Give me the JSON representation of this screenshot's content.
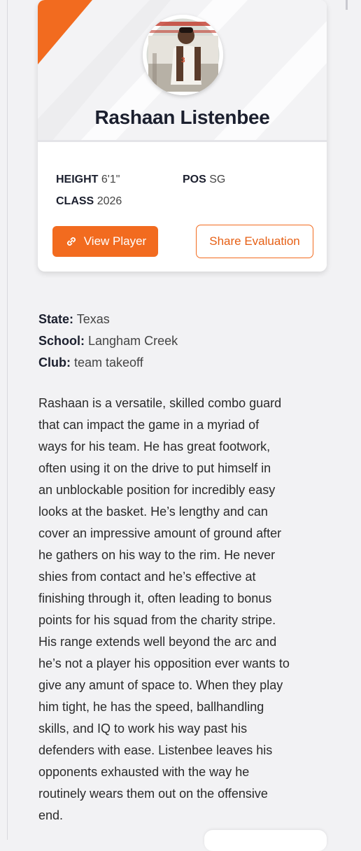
{
  "player": {
    "name": "Rashaan Listenbee",
    "height_label": "HEIGHT",
    "height_value": "6'1\"",
    "pos_label": "POS",
    "pos_value": "SG",
    "class_label": "CLASS",
    "class_value": "2026"
  },
  "actions": {
    "view_player": "View Player",
    "share_evaluation": "Share Evaluation"
  },
  "details": {
    "state_label": "State:",
    "state_value": "Texas",
    "school_label": "School:",
    "school_value": "Langham Creek",
    "club_label": "Club:",
    "club_value": "team takeoff"
  },
  "evaluation": "Rashaan is a versatile, skilled combo guard\nthat can impact the game in a myriad of\nways for his team. He has great footwork,\noften using it on the drive to put himself in\nan unblockable position for incredibly easy\nlooks at the basket. He’s lengthy and can\ncover an impressive amount of ground after\nhe gathers on his way to the rim. He never\nshies from contact and he’s effective at\nfinishing through it, often leading to bonus\npoints for his squad from the charity stripe.\nHis range extends well beyond the arc and\nhe’s not a player his opposition ever wants to\ngive any amunt of space to. When they play\nhim tight, he has the speed, ballhandling\nskills, and IQ to work his way past his\ndefenders with ease. Listenbee leaves his\nopponents exhausted with the way he\nroutinely wears them out on the offensive\nend.",
  "colors": {
    "accent": "#f26b1f",
    "heading": "#1b1f2e",
    "background": "#f2f2f4"
  },
  "icons": {
    "view_player_icon": "link-icon",
    "avatar": "player-photo"
  }
}
